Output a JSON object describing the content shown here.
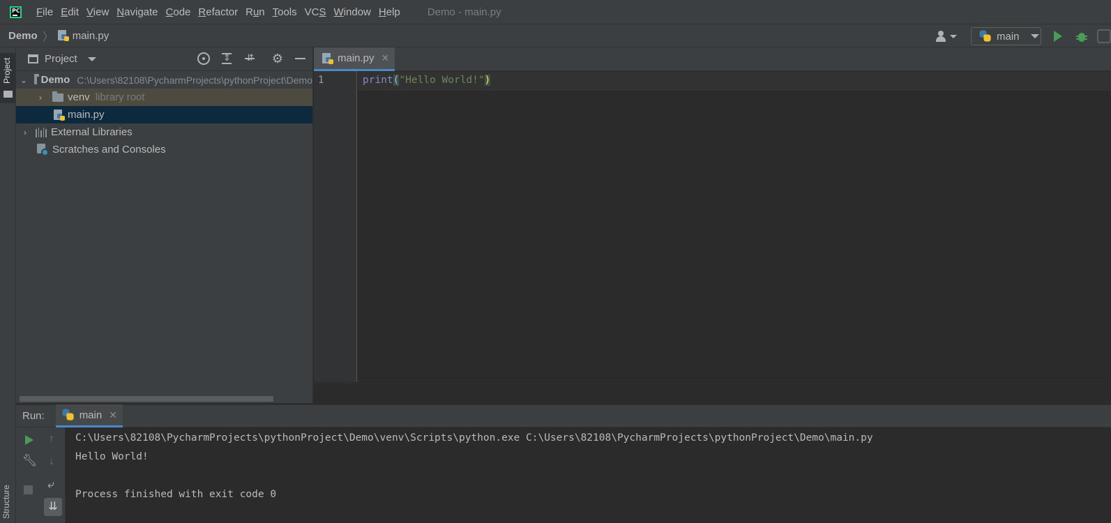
{
  "menubar": {
    "logo_text": "PC",
    "items": [
      {
        "pre": "",
        "u": "F",
        "post": "ile"
      },
      {
        "pre": "",
        "u": "E",
        "post": "dit"
      },
      {
        "pre": "",
        "u": "V",
        "post": "iew"
      },
      {
        "pre": "",
        "u": "N",
        "post": "avigate"
      },
      {
        "pre": "",
        "u": "C",
        "post": "ode"
      },
      {
        "pre": "",
        "u": "R",
        "post": "efactor"
      },
      {
        "pre": "R",
        "u": "u",
        "post": "n"
      },
      {
        "pre": "",
        "u": "T",
        "post": "ools"
      },
      {
        "pre": "VC",
        "u": "S",
        "post": ""
      },
      {
        "pre": "",
        "u": "W",
        "post": "indow"
      },
      {
        "pre": "",
        "u": "H",
        "post": "elp"
      }
    ],
    "window_title": "Demo - main.py"
  },
  "navbar": {
    "project": "Demo",
    "separator": "〉",
    "file": "main.py",
    "run_config": "main"
  },
  "left_stripe": {
    "project_tab": "Project",
    "structure_tab": "Structure"
  },
  "project_panel": {
    "title": "Project",
    "tree": {
      "root_name": "Demo",
      "root_path": "C:\\Users\\82108\\PycharmProjects\\pythonProject\\Demo",
      "venv_name": "venv",
      "venv_hint": "library root",
      "file_name": "main.py",
      "ext_libs": "External Libraries",
      "scratches": "Scratches and Consoles"
    }
  },
  "editor": {
    "tab_name": "main.py",
    "line_number": "1",
    "code": {
      "func": "print",
      "open_paren": "(",
      "string": "\"Hello World!\"",
      "close_paren": ")"
    }
  },
  "run_panel": {
    "label": "Run:",
    "tab_name": "main",
    "console": {
      "command": "C:\\Users\\82108\\PycharmProjects\\pythonProject\\Demo\\venv\\Scripts\\python.exe C:\\Users\\82108\\PycharmProjects\\pythonProject\\Demo\\main.py",
      "output": "Hello World!",
      "exit_message": "Process finished with exit code 0"
    }
  },
  "icons": {
    "menu_logo": "pycharm-logo-icon",
    "python_file": "python-file-icon",
    "run": "run-icon",
    "debug": "debug-icon"
  },
  "colors": {
    "accent": "#4a88c7",
    "run_green": "#499c54",
    "string_green": "#6a8759",
    "keyword_purple": "#8888c6",
    "selection_bg": "#0d293e",
    "venv_bg": "#4d4a40"
  }
}
